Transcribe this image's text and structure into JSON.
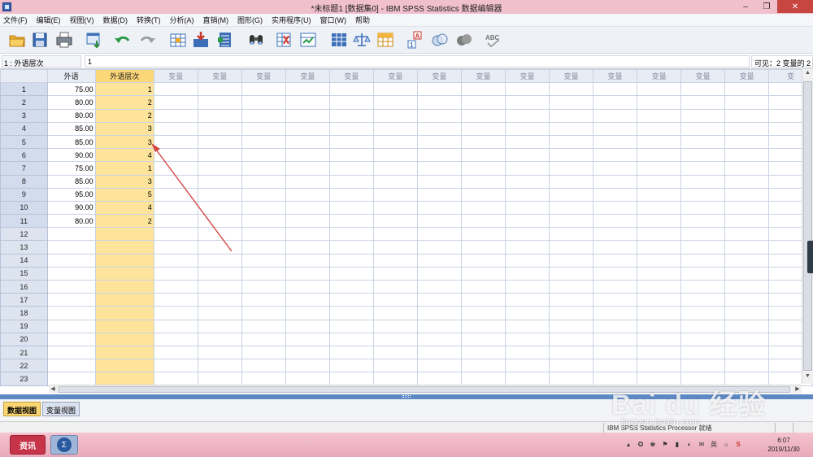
{
  "window": {
    "title": "*未标题1 [数据集0] - IBM SPSS Statistics 数据编辑器",
    "minimize": "–",
    "restore": "❐",
    "close": "✕"
  },
  "menu": [
    "文件(F)",
    "编辑(E)",
    "视图(V)",
    "数据(D)",
    "转换(T)",
    "分析(A)",
    "直销(M)",
    "图形(G)",
    "实用程序(U)",
    "窗口(W)",
    "帮助"
  ],
  "toolbar": {
    "icons": [
      "open-folder-icon",
      "save-icon",
      "print-icon",
      "dialog-recall-icon",
      "undo-icon",
      "redo-icon",
      "goto-case-icon",
      "goto-variable-icon",
      "variables-icon",
      "find-icon",
      "insert-cases-icon",
      "insert-variable-icon",
      "split-file-icon",
      "weight-cases-icon",
      "select-cases-icon",
      "value-labels-icon",
      "use-sets-icon",
      "show-all-variables-icon",
      "spelling-icon"
    ]
  },
  "editbar": {
    "cell_ref": "1 : 外语层次",
    "cell_value": "1",
    "visible_info": "可见：2 变量的 2"
  },
  "grid": {
    "columns": [
      "外语",
      "外语层次",
      "变量",
      "变量",
      "变量",
      "变量",
      "变量",
      "变量",
      "变量",
      "变量",
      "变量",
      "变量",
      "变量",
      "变量",
      "变量",
      "变量",
      "变"
    ],
    "rows": [
      [
        "75.00",
        "1"
      ],
      [
        "80.00",
        "2"
      ],
      [
        "80.00",
        "2"
      ],
      [
        "85.00",
        "3"
      ],
      [
        "85.00",
        "3"
      ],
      [
        "90.00",
        "4"
      ],
      [
        "75.00",
        "1"
      ],
      [
        "85.00",
        "3"
      ],
      [
        "95.00",
        "5"
      ],
      [
        "90.00",
        "4"
      ],
      [
        "80.00",
        "2"
      ]
    ],
    "total_rows": 23,
    "selected_column": 1,
    "selected_color": "#fde49a"
  },
  "tabs": {
    "data_view": "数据视图",
    "variable_view": "变量视图"
  },
  "status": {
    "processor": "IBM SPSS Statistics Processor 就绪"
  },
  "taskbar": {
    "youdao_label": "资讯",
    "spss_label": "Σ",
    "tray": [
      "▴",
      "✪",
      "♚",
      "⚑",
      "▮",
      "◐",
      "✉",
      "英",
      "☼",
      "S"
    ],
    "time": "6:07",
    "date": "2019/11/30"
  },
  "watermark": {
    "main": "Bai du 经验",
    "url": "jingyan.baidu.com"
  },
  "colors": {
    "titlebar": "#f0c0cd",
    "splitter": "#5c88c4",
    "arrow": "#d64545"
  }
}
